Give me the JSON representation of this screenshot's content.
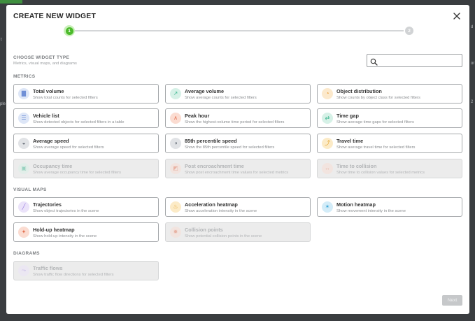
{
  "background": {
    "fragments": [
      "t",
      "ple",
      "2",
      "or",
      "d"
    ]
  },
  "modal": {
    "title": "CREATE NEW WIDGET",
    "steps": [
      "1",
      "2"
    ],
    "choose_title": "CHOOSE WIDGET TYPE",
    "choose_subtitle": "Metrics, visual maps, and diagrams",
    "search_placeholder": "",
    "sections": {
      "metrics": "METRICS",
      "visual_maps": "VISUAL MAPS",
      "diagrams": "DIAGRAMS"
    },
    "next_label": "Next"
  },
  "metrics": [
    {
      "title": "Total volume",
      "desc": "Show total counts for selected filters",
      "icon": "bar-chart-icon",
      "color": "#6f8fd6",
      "bg": "#dde6f7"
    },
    {
      "title": "Average volume",
      "desc": "Show average counts for selected filters",
      "icon": "trending-icon",
      "color": "#36b38c",
      "bg": "#d6f1e7"
    },
    {
      "title": "Object distribution",
      "desc": "Show counts by object class for selected filters",
      "icon": "pie-chart-icon",
      "color": "#e99a2f",
      "bg": "#fce9cc"
    },
    {
      "title": "Vehicle list",
      "desc": "Show detected objects for selected filters in a table",
      "icon": "list-icon",
      "color": "#6f8fd6",
      "bg": "#dde6f7"
    },
    {
      "title": "Peak hour",
      "desc": "Show the highest-volume time period for selected filters",
      "icon": "peak-icon",
      "color": "#e4704f",
      "bg": "#fbdcd1"
    },
    {
      "title": "Time gap",
      "desc": "Show average time gaps for selected filters",
      "icon": "gap-icon",
      "color": "#36b38c",
      "bg": "#d6f1e7"
    },
    {
      "title": "Average speed",
      "desc": "Show average speed for selected filters",
      "icon": "speedometer-icon",
      "color": "#5f6670",
      "bg": "#e1e3e6"
    },
    {
      "title": "85th percentile speed",
      "desc": "Show the 85th percentile speed for selected filters",
      "icon": "gauge-icon",
      "color": "#5f6670",
      "bg": "#e1e3e6"
    },
    {
      "title": "Travel time",
      "desc": "Show average travel time for selected filters",
      "icon": "route-icon",
      "color": "#e4a22b",
      "bg": "#fcebc7"
    },
    {
      "title": "Occupancy time",
      "desc": "Show average occupancy time for selected filters",
      "icon": "occupancy-icon",
      "color": "#36b38c",
      "bg": "#d6f1e7",
      "disabled": true
    },
    {
      "title": "Post encroachment time",
      "desc": "Show post encroachment time values for selected metrics",
      "icon": "encroachment-icon",
      "color": "#e4704f",
      "bg": "#fbdcd1",
      "disabled": true
    },
    {
      "title": "Time to collision",
      "desc": "Show time to collision values for selected metrics",
      "icon": "collision-time-icon",
      "color": "#e4704f",
      "bg": "#fbdcd1",
      "disabled": true
    }
  ],
  "visual_maps": [
    {
      "title": "Trajectories",
      "desc": "Show object trajectories in the scene",
      "icon": "trajectory-icon",
      "color": "#9a7de0",
      "bg": "#ebe3fa"
    },
    {
      "title": "Acceleration heatmap",
      "desc": "Show acceleration intensity in the scene",
      "icon": "flame-icon",
      "color": "#e4a22b",
      "bg": "#fcebc7"
    },
    {
      "title": "Motion heatmap",
      "desc": "Show movement intensity in the scene",
      "icon": "motion-icon",
      "color": "#3aa7d8",
      "bg": "#d3ecf8"
    },
    {
      "title": "Hold-up heatmap",
      "desc": "Show hold-up intensity in the scene",
      "icon": "holdup-icon",
      "color": "#e4704f",
      "bg": "#fbdcd1"
    },
    {
      "title": "Collision points",
      "desc": "Show potential collision points in the scene",
      "icon": "burst-icon",
      "color": "#e4704f",
      "bg": "#fbdcd1",
      "disabled": true
    }
  ],
  "diagrams": [
    {
      "title": "Traffic flows",
      "desc": "Show traffic flow directions for selected filters",
      "icon": "flow-icon",
      "color": "#9a7de0",
      "bg": "#ebe3fa",
      "disabled": true
    }
  ]
}
